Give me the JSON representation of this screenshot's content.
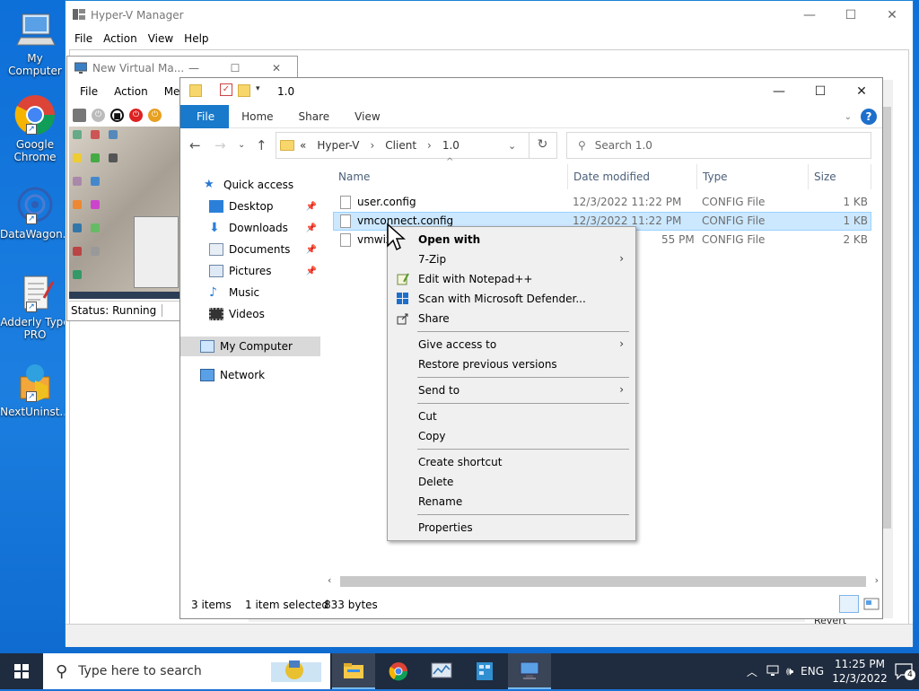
{
  "desktop_icons": [
    {
      "label": "My Computer",
      "icon": "computer-icon"
    },
    {
      "label": "Google Chrome",
      "icon": "chrome-icon"
    },
    {
      "label": "DataWagon...",
      "icon": "datawagon-icon"
    },
    {
      "label": "Adderly Type PRO",
      "icon": "notepad-icon"
    },
    {
      "label": "NextUninst...",
      "icon": "uninstaller-icon"
    }
  ],
  "hyperv": {
    "title": "Hyper-V Manager",
    "menu": [
      "File",
      "Action",
      "View",
      "Help"
    ],
    "revert_label": "Revert"
  },
  "vmconnect": {
    "title": "New Virtual Ma...",
    "menu": [
      "File",
      "Action",
      "Me"
    ],
    "status": "Status: Running"
  },
  "explorer": {
    "title_path": "1.0",
    "ribbon_tabs": [
      "File",
      "Home",
      "Share",
      "View"
    ],
    "breadcrumb": [
      "«",
      "Hyper-V",
      "Client",
      "1.0"
    ],
    "search_placeholder": "Search 1.0",
    "nav": [
      {
        "label": "Quick access",
        "icon": "star-icon",
        "pinned": false
      },
      {
        "label": "Desktop",
        "icon": "desktop-folder-icon",
        "pinned": true
      },
      {
        "label": "Downloads",
        "icon": "download-icon",
        "pinned": true
      },
      {
        "label": "Documents",
        "icon": "documents-icon",
        "pinned": true
      },
      {
        "label": "Pictures",
        "icon": "pictures-icon",
        "pinned": true
      },
      {
        "label": "Music",
        "icon": "music-icon",
        "pinned": false
      },
      {
        "label": "Videos",
        "icon": "videos-icon",
        "pinned": false
      },
      {
        "label": "My Computer",
        "icon": "computer-icon",
        "pinned": false
      },
      {
        "label": "Network",
        "icon": "network-icon",
        "pinned": false
      }
    ],
    "columns": [
      "Name",
      "Date modified",
      "Type",
      "Size"
    ],
    "files": [
      {
        "name": "user.config",
        "date": "12/3/2022 11:22 PM",
        "type": "CONFIG File",
        "size": "1 KB"
      },
      {
        "name": "vmconnect.config",
        "date": "12/3/2022 11:22 PM",
        "type": "CONFIG File",
        "size": "1 KB"
      },
      {
        "name": "vmwiz",
        "date": "55 PM",
        "type": "CONFIG File",
        "size": "2 KB"
      }
    ],
    "status_items": "3 items",
    "status_selected": "1 item selected",
    "status_size": "833 bytes"
  },
  "context_menu": [
    {
      "label": "Open with",
      "bold": true,
      "submenu": false,
      "icon": ""
    },
    {
      "label": "7-Zip",
      "bold": false,
      "submenu": true,
      "icon": ""
    },
    {
      "label": "Edit with Notepad++",
      "bold": false,
      "submenu": false,
      "icon": "notepadpp-icon"
    },
    {
      "label": "Scan with Microsoft Defender...",
      "bold": false,
      "submenu": false,
      "icon": "defender-icon"
    },
    {
      "label": "Share",
      "bold": false,
      "submenu": false,
      "icon": "share-icon"
    },
    {
      "label": "Give access to",
      "bold": false,
      "submenu": true,
      "icon": ""
    },
    {
      "label": "Restore previous versions",
      "bold": false,
      "submenu": false,
      "icon": ""
    },
    {
      "label": "Send to",
      "bold": false,
      "submenu": true,
      "icon": ""
    },
    {
      "label": "Cut",
      "bold": false,
      "submenu": false,
      "icon": ""
    },
    {
      "label": "Copy",
      "bold": false,
      "submenu": false,
      "icon": ""
    },
    {
      "label": "Create shortcut",
      "bold": false,
      "submenu": false,
      "icon": ""
    },
    {
      "label": "Delete",
      "bold": false,
      "submenu": false,
      "icon": ""
    },
    {
      "label": "Rename",
      "bold": false,
      "submenu": false,
      "icon": ""
    },
    {
      "label": "Properties",
      "bold": false,
      "submenu": false,
      "icon": ""
    }
  ],
  "taskbar": {
    "search_placeholder": "Type here to search",
    "language": "ENG",
    "time": "11:25 PM",
    "date": "12/3/2022",
    "notifications": "4"
  },
  "colors": {
    "accent": "#1979ca",
    "selection": "#cce8ff",
    "taskbar": "#1f2b3e"
  }
}
